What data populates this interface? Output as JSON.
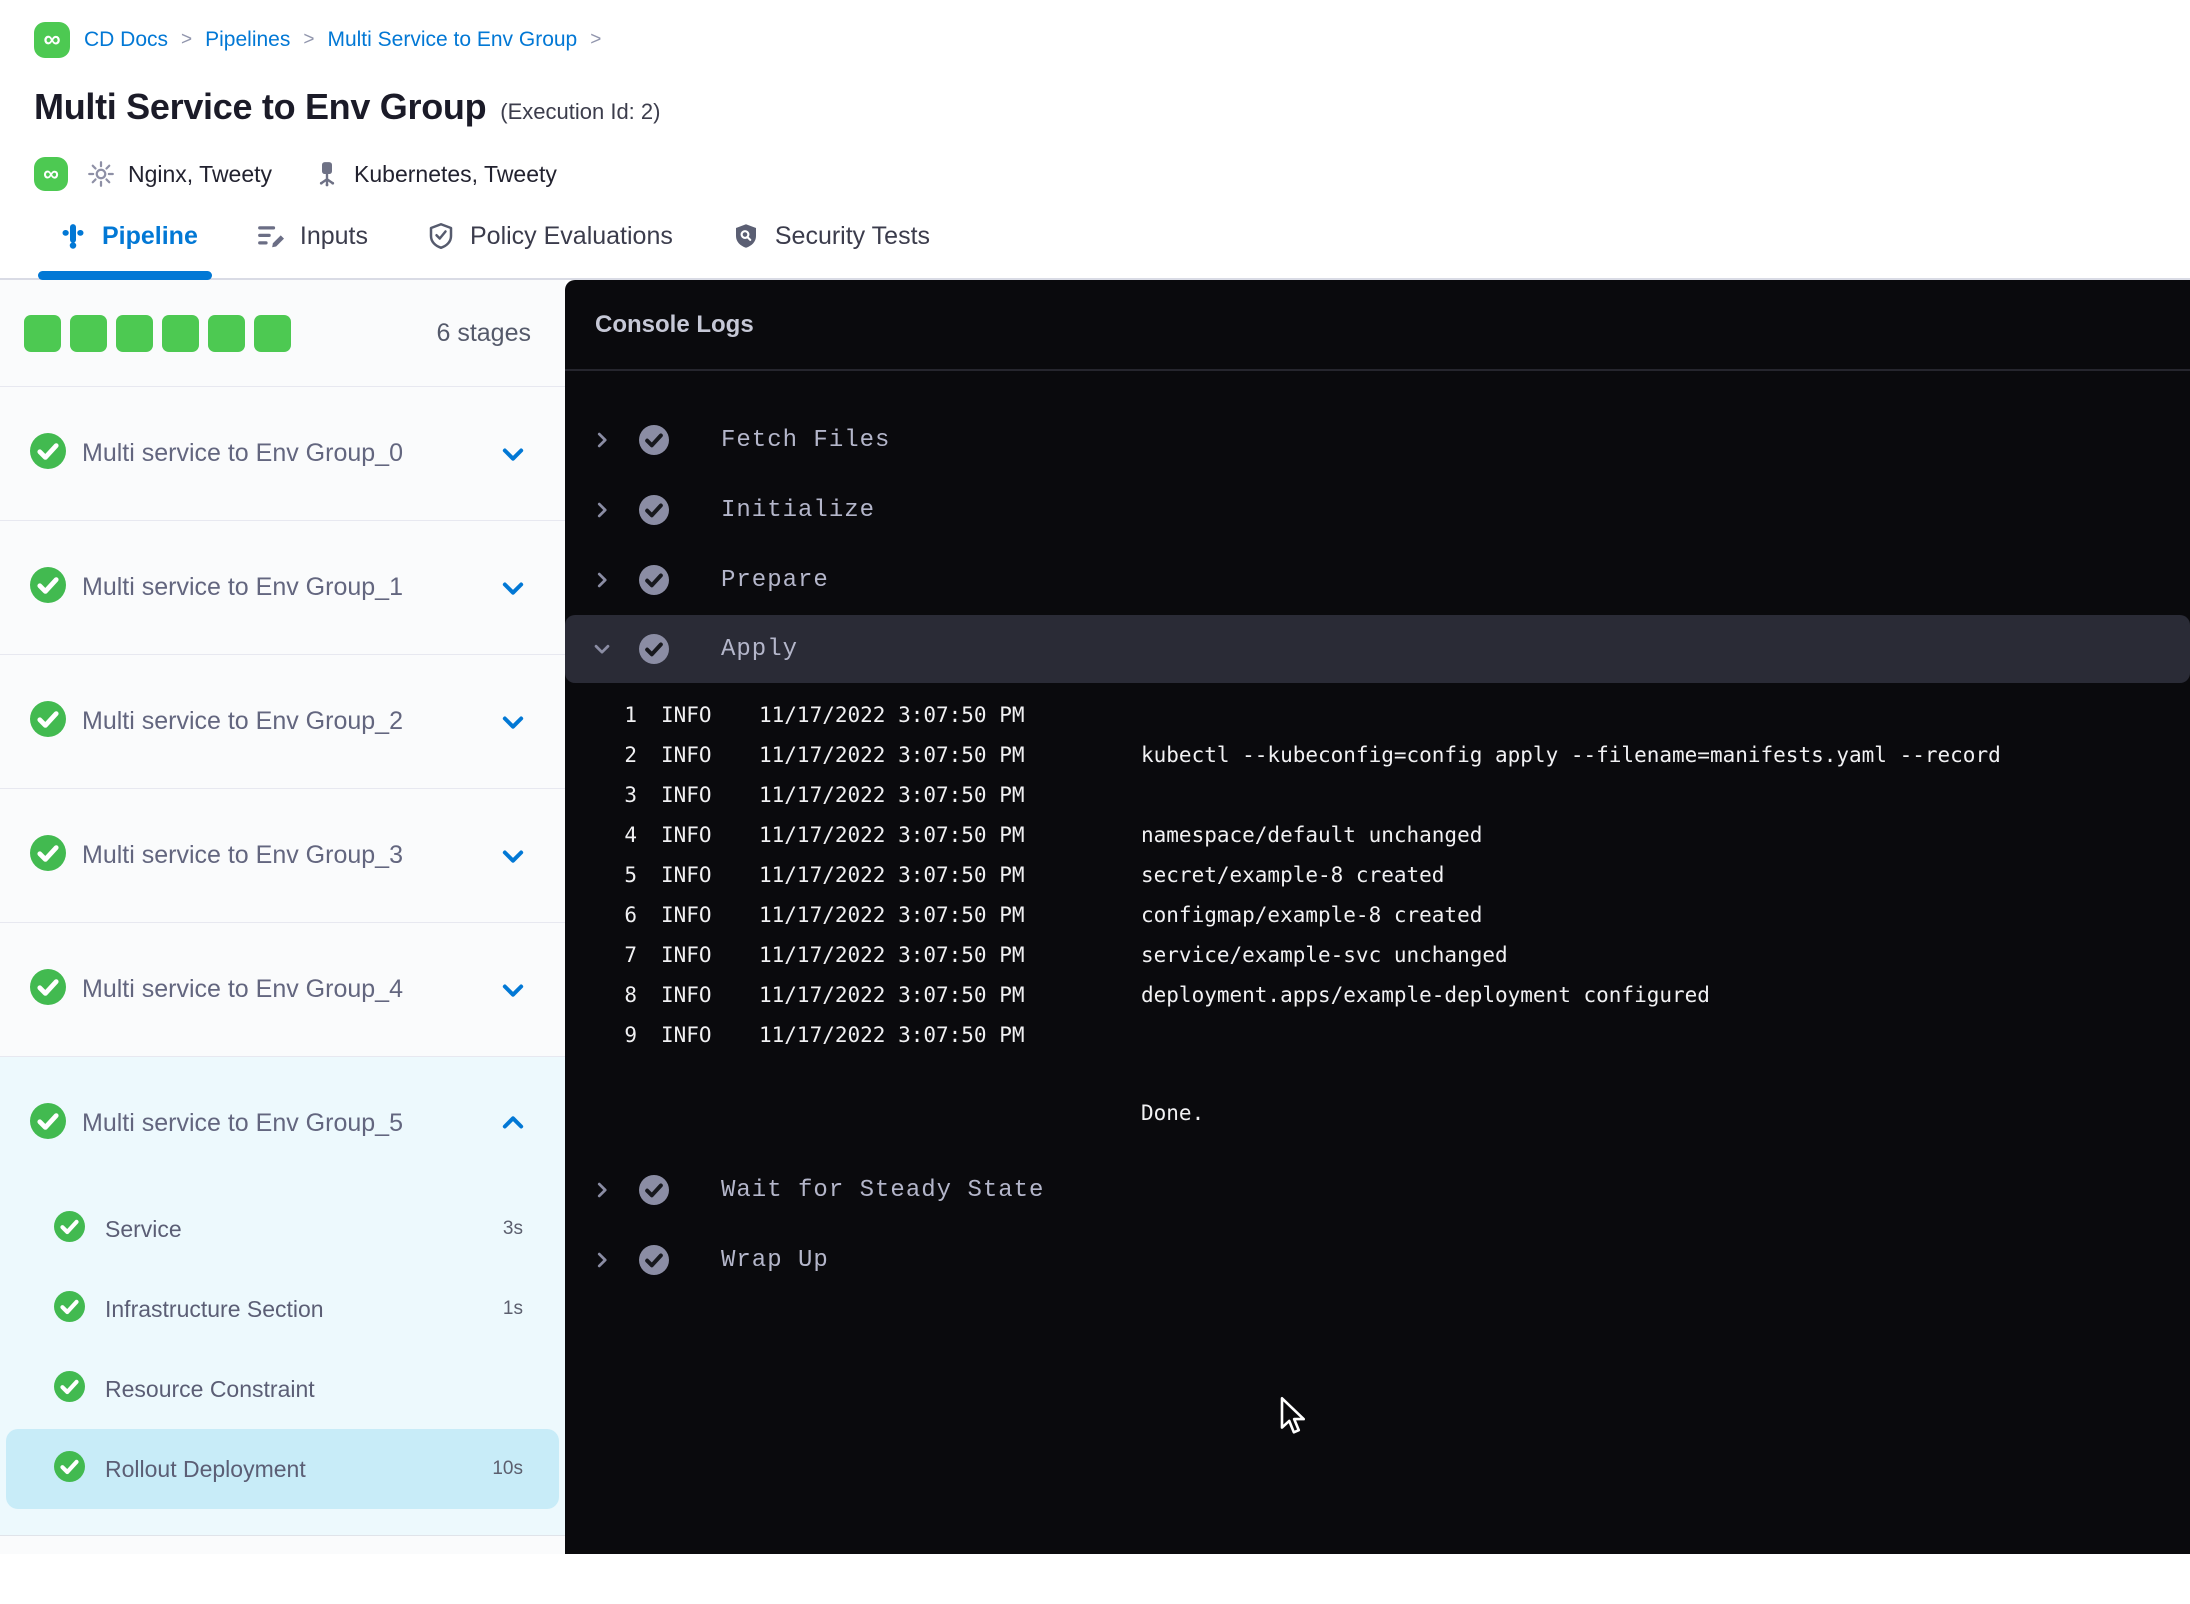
{
  "breadcrumb": {
    "items": [
      "CD Docs",
      "Pipelines",
      "Multi Service to Env Group"
    ],
    "separator": ">"
  },
  "title": {
    "text": "Multi Service to Env Group",
    "execution_id": "(Execution Id: 2)"
  },
  "meta": {
    "services": "Nginx, Tweety",
    "infrastructure": "Kubernetes, Tweety"
  },
  "tabs": [
    {
      "label": "Pipeline",
      "icon": "pipeline-icon",
      "active": true
    },
    {
      "label": "Inputs",
      "icon": "inputs-icon",
      "active": false
    },
    {
      "label": "Policy Evaluations",
      "icon": "policy-shield-check-icon",
      "active": false
    },
    {
      "label": "Security Tests",
      "icon": "security-shield-search-icon",
      "active": false
    }
  ],
  "stage_panel": {
    "count_label": "6 stages",
    "square_count": 6,
    "stages": [
      {
        "label": "Multi service to Env Group_0",
        "status": "success",
        "expanded": false
      },
      {
        "label": "Multi service to Env Group_1",
        "status": "success",
        "expanded": false
      },
      {
        "label": "Multi service to Env Group_2",
        "status": "success",
        "expanded": false
      },
      {
        "label": "Multi service to Env Group_3",
        "status": "success",
        "expanded": false
      },
      {
        "label": "Multi service to Env Group_4",
        "status": "success",
        "expanded": false
      },
      {
        "label": "Multi service to Env Group_5",
        "status": "success",
        "expanded": true,
        "steps": [
          {
            "label": "Service",
            "duration": "3s",
            "status": "success",
            "selected": false
          },
          {
            "label": "Infrastructure Section",
            "duration": "1s",
            "status": "success",
            "selected": false
          },
          {
            "label": "Resource Constraint",
            "duration": "",
            "status": "success",
            "selected": false
          },
          {
            "label": "Rollout Deployment",
            "duration": "10s",
            "status": "success",
            "selected": true
          }
        ]
      }
    ]
  },
  "console": {
    "title": "Console Logs",
    "steps": [
      {
        "label": "Fetch Files",
        "status": "success",
        "expanded": false
      },
      {
        "label": "Initialize",
        "status": "success",
        "expanded": false
      },
      {
        "label": "Prepare",
        "status": "success",
        "expanded": false
      },
      {
        "label": "Apply",
        "status": "success",
        "expanded": true,
        "logs": [
          {
            "n": "1",
            "level": "INFO",
            "time": "11/17/2022 3:07:50 PM",
            "msg": ""
          },
          {
            "n": "2",
            "level": "INFO",
            "time": "11/17/2022 3:07:50 PM",
            "msg": "kubectl --kubeconfig=config apply --filename=manifests.yaml --record"
          },
          {
            "n": "3",
            "level": "INFO",
            "time": "11/17/2022 3:07:50 PM",
            "msg": ""
          },
          {
            "n": "4",
            "level": "INFO",
            "time": "11/17/2022 3:07:50 PM",
            "msg": "namespace/default unchanged"
          },
          {
            "n": "5",
            "level": "INFO",
            "time": "11/17/2022 3:07:50 PM",
            "msg": "secret/example-8 created"
          },
          {
            "n": "6",
            "level": "INFO",
            "time": "11/17/2022 3:07:50 PM",
            "msg": "configmap/example-8 created"
          },
          {
            "n": "7",
            "level": "INFO",
            "time": "11/17/2022 3:07:50 PM",
            "msg": "service/example-svc unchanged"
          },
          {
            "n": "8",
            "level": "INFO",
            "time": "11/17/2022 3:07:50 PM",
            "msg": "deployment.apps/example-deployment configured"
          },
          {
            "n": "9",
            "level": "INFO",
            "time": "11/17/2022 3:07:50 PM",
            "msg": ""
          },
          {
            "n": "",
            "level": "",
            "time": "",
            "msg": "Done."
          }
        ]
      },
      {
        "label": "Wait for Steady State",
        "status": "success",
        "expanded": false
      },
      {
        "label": "Wrap Up",
        "status": "success",
        "expanded": false
      }
    ]
  },
  "icons": {
    "logo": "∞",
    "gear": "gear-outline",
    "kubernetes": "node-tree",
    "success_check": "✓ in green circle",
    "console_check": "✓ in gray circle",
    "chevron_down": "⌄",
    "chevron_up": "⌃",
    "chevron_right": "›",
    "cursor": "arrow-pointer"
  },
  "colors": {
    "accent_blue": "#0278d5",
    "success_green": "#42ba50",
    "square_green": "#4dc952",
    "console_bg": "#0a0a0d",
    "console_highlight": "#2a2b36",
    "selected_step_bg": "#c8ecf8",
    "expanded_group_bg": "#edf9fd"
  }
}
